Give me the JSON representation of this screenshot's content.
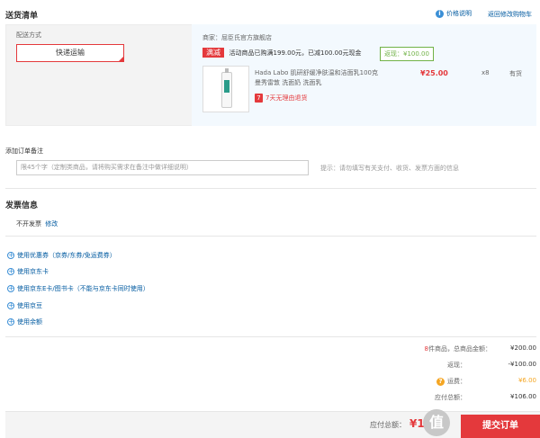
{
  "header": {
    "title": "送货清单",
    "price_explain": "价格说明",
    "back_to_cart": "返回修改购物车"
  },
  "shipping": {
    "method_label": "配送方式",
    "method_value": "快递运输"
  },
  "shop": {
    "merchant": "商家：屈臣氏官方旗舰店",
    "promo_tag": "满减",
    "promo_text": "活动商品已购满199.00元，已减100.00元现金",
    "return_badge": "返现：¥100.00",
    "product": {
      "name_line1": "Hada Labo 肌研舒缓净肤温和洁面乳100克",
      "name_line2": "曼秀雷敦 洗面奶 洗面乳",
      "price": "¥25.00",
      "qty": "x8",
      "stock": "有货",
      "return_policy": "7天无理由退货",
      "return_icon": "7"
    }
  },
  "note": {
    "label": "添加订单备注",
    "placeholder": "限45个字（定制类商品，请将购买需求在备注中做详细说明）",
    "hint": "提示：请勿填写有关支付、收货、发票方面的信息"
  },
  "invoice": {
    "title": "发票信息",
    "value": "不开发票",
    "edit": "修改"
  },
  "options": [
    "使用优惠券（京券/东券/免运费券）",
    "使用京东卡",
    "使用京东E卡/图书卡（不能与京东卡同时使用）",
    "使用京豆",
    "使用余额"
  ],
  "summary": {
    "count": "8",
    "count_suffix": "件商品，总商品金额：",
    "total": "¥200.00",
    "rebate_label": "返现：",
    "rebate": "-¥100.00",
    "shipping_label": "运费：",
    "shipping_fee": "¥6.00",
    "payable_label": "应付总额：",
    "payable": "¥106.00"
  },
  "footer": {
    "payable_label": "应付总额：",
    "payable_amount": "¥10",
    "submit": "提交订单",
    "watermark": "值"
  },
  "colors": {
    "accent_red": "#e4393c",
    "link_blue": "#005aa0",
    "green": "#71b247",
    "orange": "#f5a623"
  }
}
